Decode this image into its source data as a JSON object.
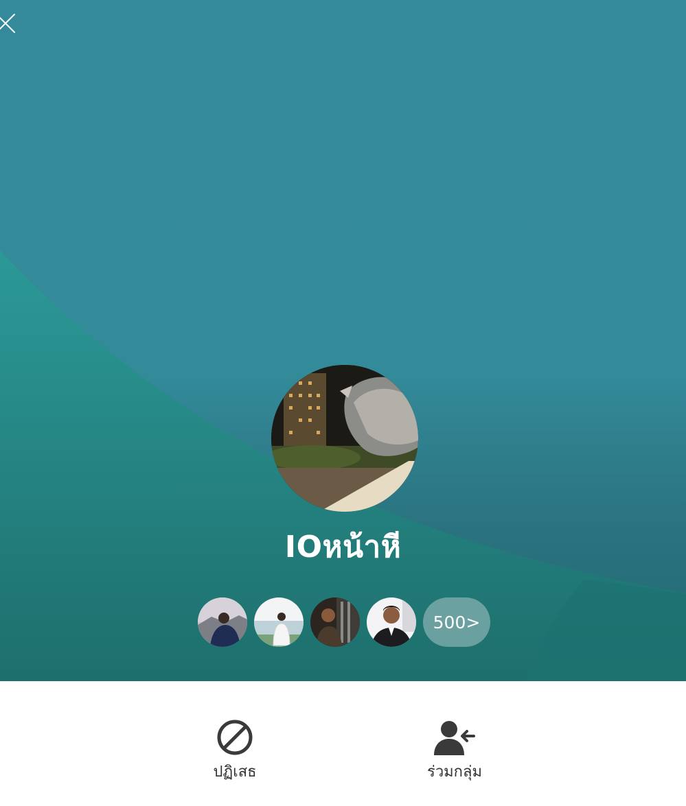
{
  "group": {
    "name": "IOหน้าหี"
  },
  "members": {
    "count_label": "500>"
  },
  "actions": {
    "reject_label": "ปฏิเสธ",
    "join_label": "ร่วมกลุ่ม"
  },
  "icons": {
    "close": "close-icon",
    "reject": "block-icon",
    "join": "join-group-icon"
  },
  "colors": {
    "background_teal": "#338a99",
    "action_icon": "#3a3a3a"
  }
}
